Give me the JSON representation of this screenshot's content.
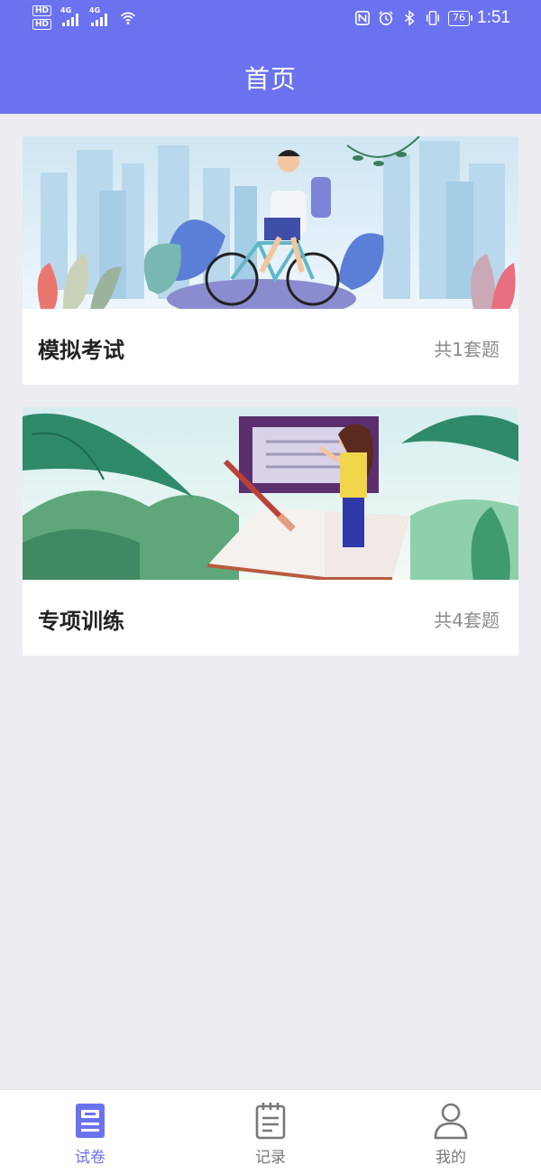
{
  "status_bar": {
    "left": {
      "sim1": "HD",
      "sim2": "HD",
      "net1": "4G",
      "net2": "4G"
    },
    "battery": "76",
    "time": "1:51",
    "icons": [
      "nfc-icon",
      "alarm-icon",
      "bluetooth-icon",
      "vibrate-icon",
      "battery-icon"
    ]
  },
  "header": {
    "title": "首页"
  },
  "cards": [
    {
      "title": "模拟考试",
      "count": "共1套题",
      "illustration": "cyclist-illustration"
    },
    {
      "title": "专项训练",
      "count": "共4套题",
      "illustration": "reading-illustration"
    }
  ],
  "tabs": [
    {
      "label": "试卷",
      "icon": "exam-paper-icon",
      "active": true
    },
    {
      "label": "记录",
      "icon": "clipboard-icon",
      "active": false
    },
    {
      "label": "我的",
      "icon": "user-icon",
      "active": false
    }
  ],
  "colors": {
    "accent": "#6a72f0",
    "background": "#ececf1",
    "inactive": "#777777",
    "count_text": "#8b8b8b"
  }
}
